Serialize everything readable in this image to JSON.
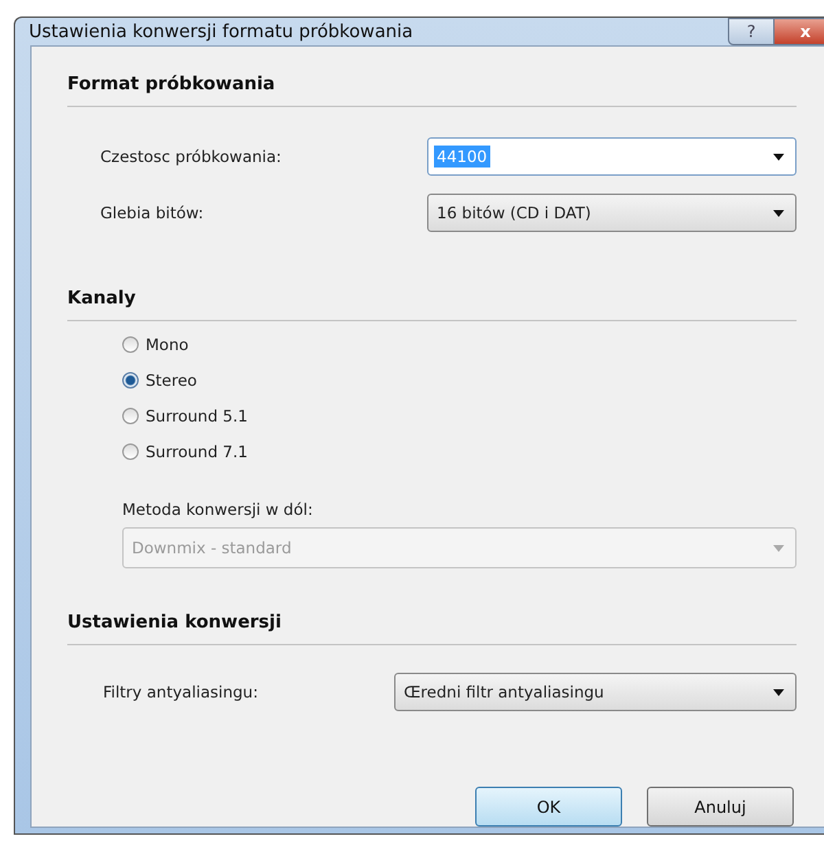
{
  "window": {
    "title": "Ustawienia konwersji formatu próbkowania",
    "help_glyph": "?",
    "close_glyph": "x"
  },
  "sample_format": {
    "heading": "Format próbkowania",
    "fields": [
      {
        "label": "Czestosc próbkowania:",
        "value": "44100",
        "kind": "editable",
        "highlighted": true
      },
      {
        "label": "Glebia bitów:",
        "value": "16 bitów (CD i DAT)",
        "kind": "dropdown",
        "highlighted": false
      }
    ]
  },
  "channels": {
    "heading": "Kanaly",
    "options": [
      {
        "label": "Mono",
        "selected": false
      },
      {
        "label": "Stereo",
        "selected": true
      },
      {
        "label": "Surround 5.1",
        "selected": false
      },
      {
        "label": "Surround 7.1",
        "selected": false
      }
    ],
    "downmix": {
      "label": "Metoda konwersji w dól:",
      "value": "Downmix - standard",
      "disabled": true
    }
  },
  "conversion": {
    "heading": "Ustawienia konwersji",
    "field": {
      "label": "Filtry antyaliasingu:",
      "value": "Œredni filtr antyaliasingu"
    }
  },
  "buttons": [
    {
      "label": "OK",
      "default": true
    },
    {
      "label": "Anuluj",
      "default": false
    }
  ]
}
